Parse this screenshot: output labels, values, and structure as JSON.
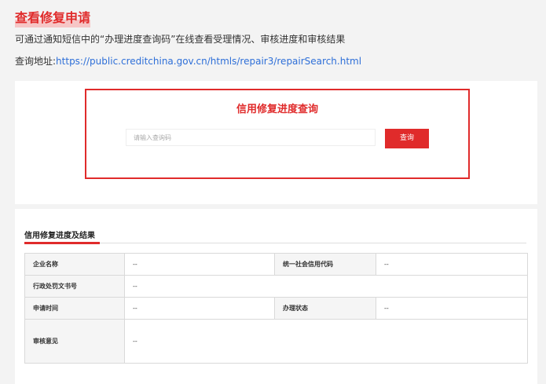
{
  "heading": "查看修复申请",
  "description": "可通过通知短信中的“办理进度查询码”在线查看受理情况、审核进度和审核结果",
  "address": {
    "label": "查询地址:",
    "url": "https://public.creditchina.gov.cn/htmls/repair3/repairSearch.html"
  },
  "search": {
    "title": "信用修复进度查询",
    "placeholder": "请输入查询码",
    "button_label": "查询"
  },
  "result": {
    "section_title": "信用修复进度及结果",
    "rows": [
      {
        "label1": "企业名称",
        "value1": "--",
        "label2": "统一社会信用代码",
        "value2": "--"
      },
      {
        "label1": "行政处罚文书号",
        "value1": "--"
      },
      {
        "label1": "申请时间",
        "value1": "--",
        "label2": "办理状态",
        "value2": "--"
      },
      {
        "label1": "审核意见",
        "value1": "--"
      }
    ]
  },
  "colors": {
    "accent": "#e02b2b",
    "link": "#2e6fd8",
    "background": "#f3f3f3"
  }
}
